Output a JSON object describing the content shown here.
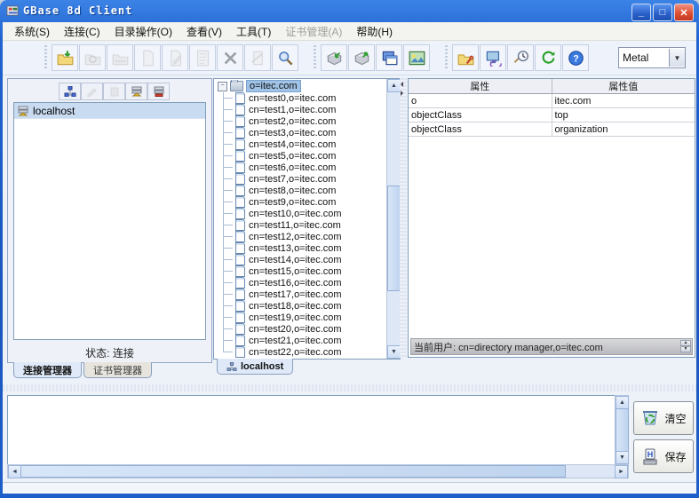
{
  "window": {
    "title": "GBase 8d Client"
  },
  "menu": {
    "items": [
      {
        "label": "系统(S)"
      },
      {
        "label": "连接(C)"
      },
      {
        "label": "目录操作(O)"
      },
      {
        "label": "查看(V)"
      },
      {
        "label": "工具(T)"
      },
      {
        "label": "证书管理(A)",
        "disabled": true
      },
      {
        "label": "帮助(H)"
      }
    ]
  },
  "toolbar": {
    "theme_select": {
      "value": "Metal"
    },
    "icons": [
      "open-connection",
      "refresh-disabled",
      "folder-disabled",
      "page-disabled",
      "edit-disabled",
      "list-disabled",
      "delete",
      "link-disabled",
      "search",
      "import-data",
      "export-data",
      "cascade-windows",
      "snapshot",
      "configure",
      "network-computer",
      "schedule",
      "refresh",
      "help"
    ],
    "accent_colors": {
      "folder": "#f2d879",
      "arrow_green": "#2e9e2e",
      "help_blue": "#3a7ae0"
    }
  },
  "left_panel": {
    "connections": [
      {
        "label": "localhost"
      }
    ],
    "status": "状态: 连接",
    "tabs": [
      {
        "label": "连接管理器",
        "active": true
      },
      {
        "label": "证书管理器",
        "active": false
      }
    ]
  },
  "tree_panel": {
    "root": "o=itec.com",
    "children": [
      "cn=test0,o=itec.com",
      "cn=test1,o=itec.com",
      "cn=test2,o=itec.com",
      "cn=test3,o=itec.com",
      "cn=test4,o=itec.com",
      "cn=test5,o=itec.com",
      "cn=test6,o=itec.com",
      "cn=test7,o=itec.com",
      "cn=test8,o=itec.com",
      "cn=test9,o=itec.com",
      "cn=test10,o=itec.com",
      "cn=test11,o=itec.com",
      "cn=test12,o=itec.com",
      "cn=test13,o=itec.com",
      "cn=test14,o=itec.com",
      "cn=test15,o=itec.com",
      "cn=test16,o=itec.com",
      "cn=test17,o=itec.com",
      "cn=test18,o=itec.com",
      "cn=test19,o=itec.com",
      "cn=test20,o=itec.com",
      "cn=test21,o=itec.com",
      "cn=test22,o=itec.com"
    ],
    "tab": "localhost"
  },
  "attributes_panel": {
    "columns": [
      "属性",
      "属性值"
    ],
    "rows": [
      [
        "o",
        "itec.com"
      ],
      [
        "objectClass",
        "top"
      ],
      [
        "objectClass",
        "organization"
      ]
    ],
    "current_user": "当前用户: cn=directory manager,o=itec.com"
  },
  "log_panel": {
    "content": "",
    "clear_label": "清空",
    "save_label": "保存"
  }
}
